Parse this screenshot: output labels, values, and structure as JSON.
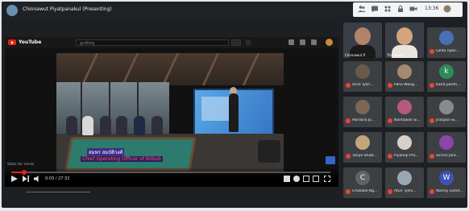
{
  "meeting": {
    "presenter_name": "Chinnawut Piyatpanakul (Presenting)",
    "clock": "13:36"
  },
  "youtube": {
    "brand": "YouTube",
    "search_value": "guilling",
    "time": "0:03 / 27:32",
    "stats_label": "Stats for nerds"
  },
  "video": {
    "lower_third_name": "สมพร สมบัติวงศ์",
    "lower_third_title": "Chief Operating Officer of Bitkub",
    "progress_fraction": 0.04
  },
  "participants": {
    "video_tiles": [
      {
        "name": "Chinnawut P.",
        "face_color": "#b0836a",
        "body_color": "#1a1a1a"
      },
      {
        "name": "Thanakorn",
        "face_color": "#d4a57d",
        "body_color": "#e8e4de"
      }
    ],
    "tiles": [
      {
        "name": "Lalita npoil...",
        "letter": "",
        "color": "#4b6fb5"
      },
      {
        "name": "Arun Tysh...",
        "letter": "",
        "color": "#6a5a4c"
      },
      {
        "name": "Pana Wong...",
        "letter": "",
        "color": "#a68a70"
      },
      {
        "name": "Kanit panth...",
        "letter": "k",
        "color": "#2e8b57"
      },
      {
        "name": "Parillara Jo...",
        "letter": "",
        "color": "#7a6855"
      },
      {
        "name": "Nantawan Si...",
        "letter": "",
        "color": "#b55a7a"
      },
      {
        "name": "Jiraspon w...",
        "letter": "",
        "color": "#8a8a8a"
      },
      {
        "name": "Tanya Stubt...",
        "letter": "",
        "color": "#c4a47c"
      },
      {
        "name": "Piyanop Pro...",
        "letter": "",
        "color": "#d8d0c8"
      },
      {
        "name": "Siriron Jara...",
        "letter": "",
        "color": "#8e44ad"
      },
      {
        "name": "Chalobel Ng...",
        "letter": "C",
        "color": "#5f6368"
      },
      {
        "name": "Atun Tyshi...",
        "letter": "",
        "color": "#9aa7b3"
      },
      {
        "name": "Wanny Lomd...",
        "letter": "W",
        "color": "#3f51b5"
      }
    ]
  },
  "colors": {
    "accent": "#e62117",
    "muted_mic": "#ea4335",
    "lower_third_bg": "#3d2f86"
  }
}
